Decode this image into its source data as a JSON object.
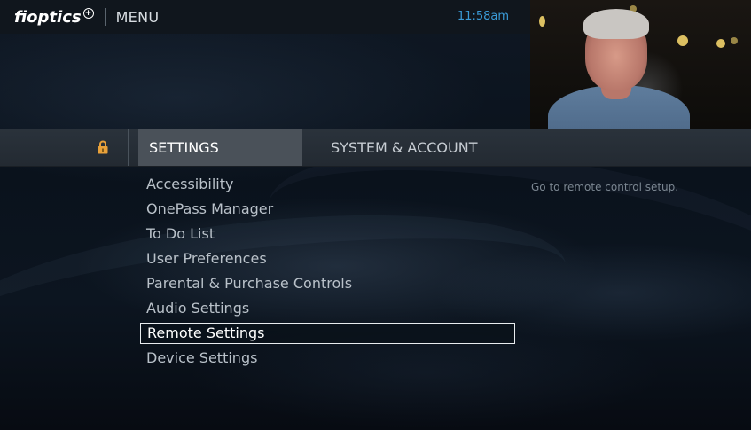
{
  "header": {
    "brand": "fioptics",
    "brand_plus": "+",
    "title": "MENU",
    "time": "11:58am"
  },
  "tabs": [
    {
      "label": "SETTINGS",
      "active": true
    },
    {
      "label": "SYSTEM & ACCOUNT",
      "active": false
    }
  ],
  "lock_icon": "lock-icon",
  "menu": {
    "items": [
      {
        "label": "Accessibility"
      },
      {
        "label": "OnePass Manager"
      },
      {
        "label": "To Do List"
      },
      {
        "label": "User Preferences"
      },
      {
        "label": "Parental & Purchase Controls"
      },
      {
        "label": "Audio Settings"
      },
      {
        "label": "Remote Settings",
        "selected": true
      },
      {
        "label": "Device Settings"
      }
    ],
    "description": "Go to remote control setup."
  },
  "colors": {
    "accent_time": "#3a9bd8",
    "lock": "#e8a13a",
    "selection_border": "#e8ecef"
  }
}
